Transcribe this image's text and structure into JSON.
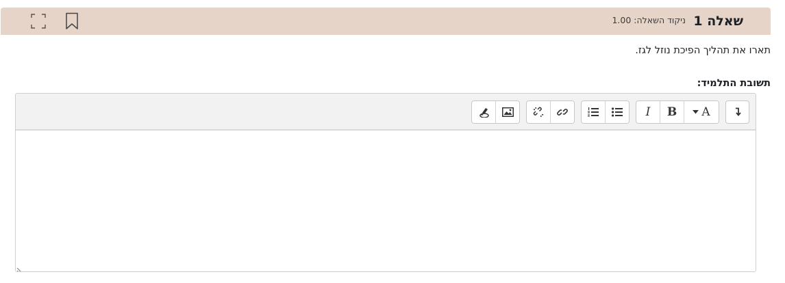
{
  "question": {
    "title": "שאלה 1",
    "grade": "ניקוד השאלה: 1.00",
    "text": "תארו את תהליך הפיכת נוזל לגז.",
    "answer_label": "תשובת התלמיד:"
  },
  "header_icons": [
    "flag-bookmark-icon",
    "fullscreen-icon"
  ],
  "toolbar": {
    "bold_label": "B",
    "italic_label": "I",
    "font_color_label": "A",
    "buttons": [
      "show-more-icon",
      "font-color-button",
      "bold-button",
      "italic-button",
      "unordered-list-button",
      "ordered-list-button",
      "link-button",
      "unlink-button",
      "image-button",
      "record-media-button"
    ]
  },
  "colors": {
    "header_bg": "#e6d4c8",
    "toolbar_bg": "#f2f2f2"
  }
}
